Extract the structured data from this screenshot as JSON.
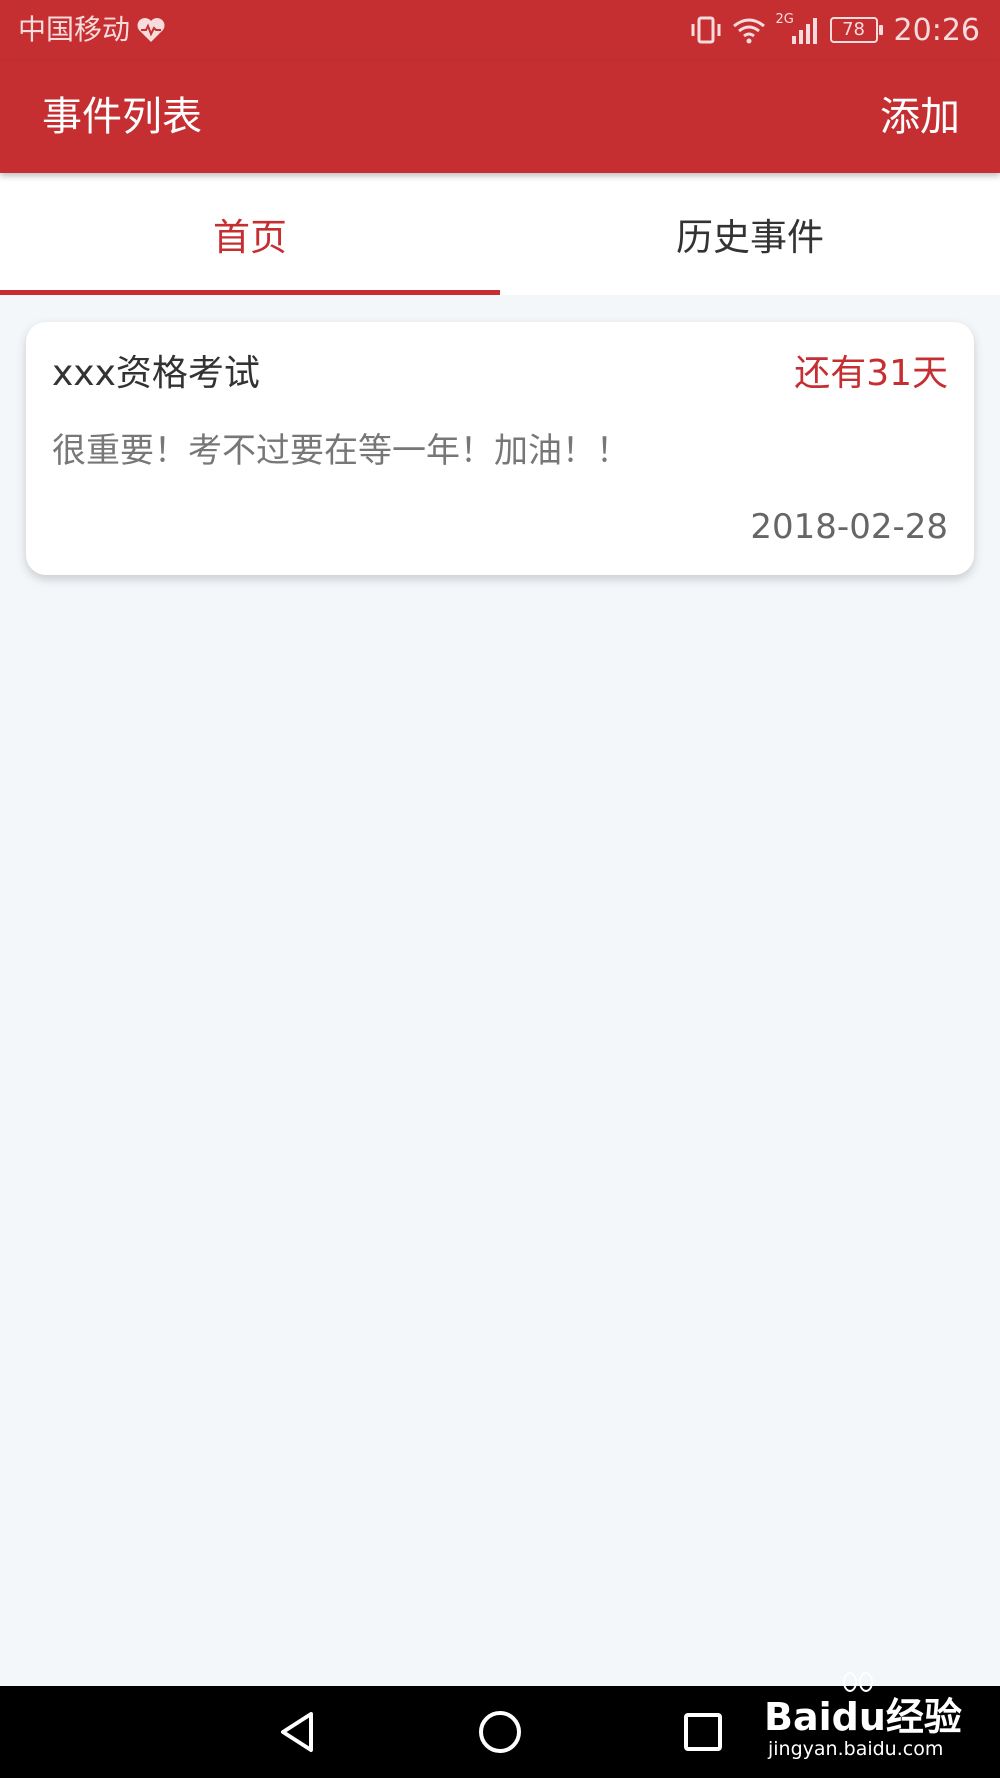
{
  "status_bar": {
    "carrier": "中国移动",
    "network": "2G",
    "battery": "78",
    "time": "20:26"
  },
  "app_bar": {
    "title": "事件列表",
    "add_label": "添加"
  },
  "tabs": [
    {
      "label": "首页",
      "selected": true
    },
    {
      "label": "历史事件",
      "selected": false
    }
  ],
  "events": [
    {
      "title": "xxx资格考试",
      "countdown": "还有31天",
      "description": "很重要！考不过要在等一年！加油！！",
      "date": "2018-02-28"
    }
  ],
  "watermark": {
    "brand": "Baidu经验",
    "url": "jingyan.baidu.com"
  },
  "colors": {
    "primary": "#c62f32",
    "background": "#f3f7fa",
    "card": "#ffffff",
    "title_text": "#333333",
    "secondary_text": "#777777"
  }
}
